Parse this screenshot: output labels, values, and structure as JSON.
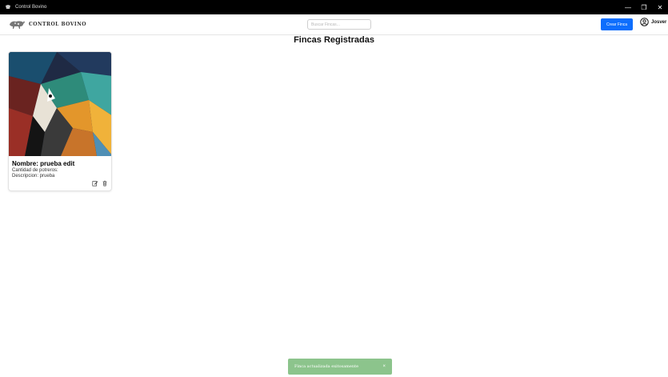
{
  "window": {
    "title": "Control Bovino",
    "controls": {
      "minimize": "—",
      "restore": "❐",
      "close": "✕"
    }
  },
  "navbar": {
    "brand_text": "CONTROL BOVINO",
    "search_placeholder": "Buscar Fincas...",
    "create_button": "Crear Finca",
    "user_name": "Josver"
  },
  "page": {
    "title": "Fincas Registradas"
  },
  "cards": [
    {
      "name_line": "Nombre: prueba edit",
      "potreros_line": "Cantidad de potreros:",
      "description_line": "Descripcion: prueba",
      "icons": [
        "edit-icon",
        "trash-icon"
      ]
    }
  ],
  "toast": {
    "message": "Finca actualizada exitosamente",
    "close": "×"
  },
  "colors": {
    "primary": "#0d6efd",
    "toast_bg": "#8cc48c",
    "titlebar": "#000000"
  }
}
